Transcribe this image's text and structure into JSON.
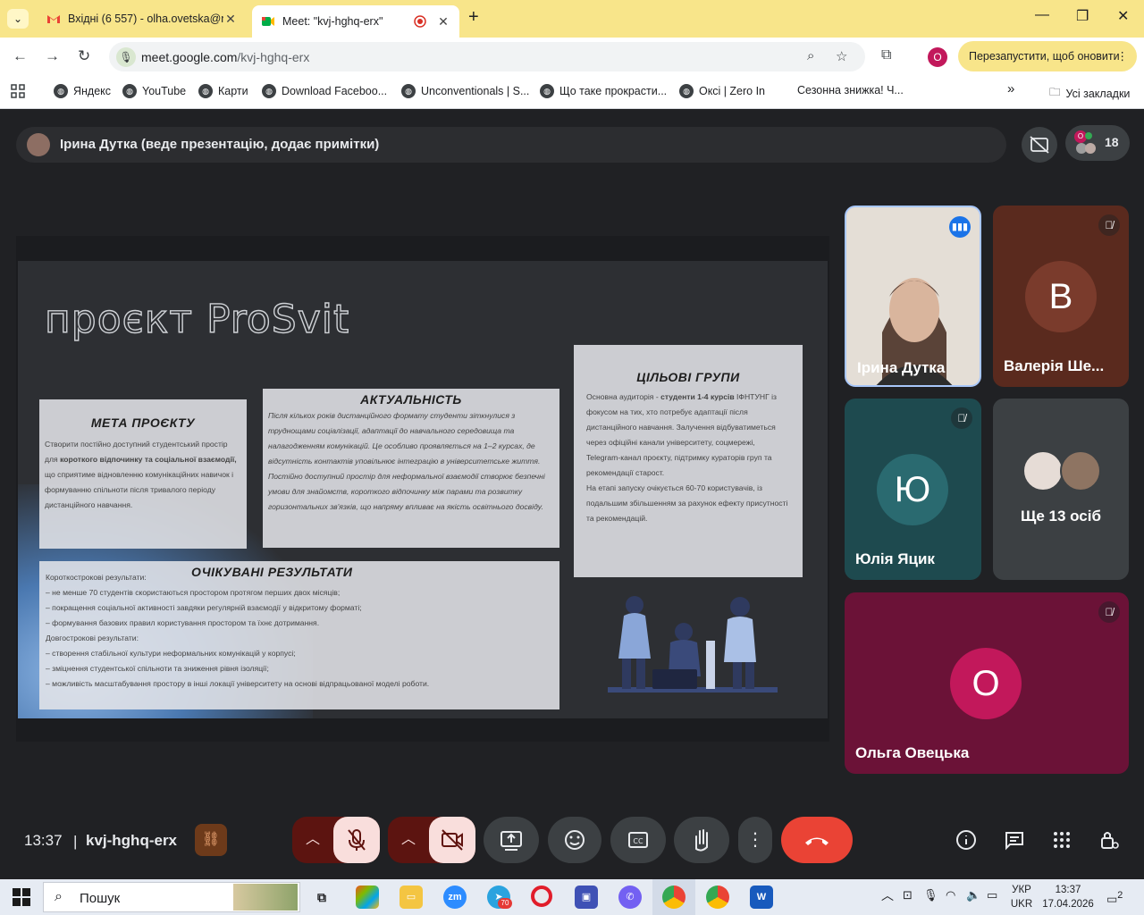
{
  "browser": {
    "tabs": [
      {
        "title": "Вхідні (6 557) - olha.ovetska@n",
        "close": "✕"
      },
      {
        "title": "Meet: \"kvj-hghq-erx\"",
        "close": "✕"
      }
    ],
    "new_tab": "+",
    "window_controls": {
      "minimize": "—",
      "restore": "❐",
      "close": "✕"
    },
    "url_host": "meet.google.com",
    "url_path": "/kvj-hghq-erx",
    "profile_initial": "O",
    "relaunch_label": "Перезапустити, щоб оновити",
    "relaunch_menu": "⋮",
    "bookmarks": [
      "Яндекс",
      "YouTube",
      "Карти",
      "Download Faceboo...",
      "Unconventionals | S...",
      "Що таке прокрасти...",
      "Окcі | Zero In",
      "Сезонна знижка! Ч..."
    ],
    "bookmarks_overflow": "»",
    "all_bookmarks": "Усі закладки"
  },
  "meet": {
    "presenter_banner": "Ірина Дутка (веде презентацію, додає примітки)",
    "people_count": "18",
    "people_badge": "O",
    "slide": {
      "title": "проєкт ProSvit",
      "goal": {
        "heading": "МЕТА ПРОЄКТУ",
        "text_a": "Створити постійно доступний студентський простір для ",
        "text_bold": "короткого відпочинку та соціальної взаємодії,",
        "text_b": " що сприятиме відновленню комунікаційних навичок і формуванню спільноти після тривалого періоду дистанційного навчання."
      },
      "relevance": {
        "heading": "АКТУАЛЬНІСТЬ",
        "text": "Після кількох років дистанційного формату студенти зіткнулися з труднощами соціалізації, адаптації до навчального середовища та налагодженням комунікацій. Це особливо проявляється на 1–2 курсах, де відсутність контактів уповільнює інтеграцію в університетське життя. Постійно доступний простір для неформальної взаємодії створює безпечні умови для знайомств, короткого відпочинку між парами та розвитку горизонтальних зв'язків, що напряму впливає на якість освітнього досвіду."
      },
      "targets": {
        "heading": "ЦІЛЬОВІ ГРУПИ",
        "text_a": "Основна аудиторія - ",
        "text_bold": "студенти 1-4 курсів",
        "text_b": " ІФНТУНГ із фокусом на тих, хто потребує адаптації після дистанційного навчання. Залучення відбуватиметься через офіційні канали університету, соцмережі, Telegram-канал проєкту, підтримку кураторів груп та рекомендації старост.",
        "text_c": "На етапі запуску очікується 60-70 користувачів, із подальшим збільшенням за рахунок ефекту присутності та рекомендацій."
      },
      "results": {
        "heading": "ОЧІКУВАНІ РЕЗУЛЬТАТИ",
        "lines": [
          "Короткострокові результати:",
          "– не менше 70 студентів скористаються простором протягом перших двох місяців;",
          "– покращення соціальної активності завдяки регулярній взаємодії у відкритому форматі;",
          "– формування базових правил користування простором та їхнє дотримання.",
          "Довгострокові результати:",
          "– створення стабільної культури неформальних комунікацій у корпусі;",
          "– зміцнення студентської спільноти та зниження рівня ізоляції;",
          "– можливість масштабування простору в інші локації університету на основі відпрацьованої моделі роботи."
        ]
      }
    },
    "tiles": [
      {
        "name": "Ірина Дутка",
        "initial": ""
      },
      {
        "name": "Валерія Ше...",
        "initial": "В"
      },
      {
        "name": "Юлія Яцик",
        "initial": "Ю"
      },
      {
        "name": "Ще 13 осіб",
        "initial": ""
      },
      {
        "name": "Ольга Овецька",
        "initial": "О"
      }
    ],
    "bottom": {
      "time": "13:37",
      "separator": "|",
      "meeting_code": "kvj-hghq-erx"
    }
  },
  "taskbar": {
    "search_label": "Пошук",
    "lang": "УКР",
    "lang2": "UKR",
    "time": "13:37",
    "date": "17.04.2026",
    "telegram_badge": "70",
    "notifications": "2"
  },
  "colors": {
    "tab_bar": "#f8e58a",
    "meet_bg": "#202124",
    "hangup": "#ea4335",
    "tile_b": "#5a2a1e",
    "tile_yu": "#1e4a4f",
    "tile_o": "#6b1237",
    "avatar_o": "#c2185b"
  }
}
